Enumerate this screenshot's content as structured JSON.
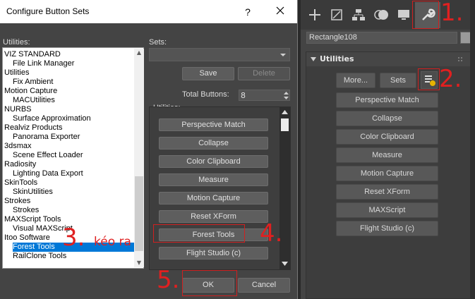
{
  "dialog": {
    "title": "Configure Button Sets",
    "help": "?",
    "utilities_label": "Utilities:",
    "sets_label": "Sets:",
    "save": "Save",
    "delete": "Delete",
    "total_buttons_label": "Total Buttons:",
    "total_buttons_value": "8",
    "utilities_label2": "Utilities:",
    "ok": "OK",
    "cancel": "Cancel",
    "list": [
      {
        "text": "VIZ STANDARD",
        "indent": false
      },
      {
        "text": "File Link Manager",
        "indent": true
      },
      {
        "text": "Utilities",
        "indent": false
      },
      {
        "text": "Fix Ambient",
        "indent": true
      },
      {
        "text": "Motion Capture",
        "indent": false
      },
      {
        "text": "MACUtilities",
        "indent": true
      },
      {
        "text": "NURBS",
        "indent": false
      },
      {
        "text": "Surface Approximation",
        "indent": true
      },
      {
        "text": "Realviz Products",
        "indent": false
      },
      {
        "text": "Panorama Exporter",
        "indent": true
      },
      {
        "text": "3dsmax",
        "indent": false
      },
      {
        "text": "Scene Effect Loader",
        "indent": true
      },
      {
        "text": "Radiosity",
        "indent": false
      },
      {
        "text": "Lighting Data Export",
        "indent": true
      },
      {
        "text": "SkinTools",
        "indent": false
      },
      {
        "text": "SkinUtilities",
        "indent": true
      },
      {
        "text": "Strokes",
        "indent": false
      },
      {
        "text": "Strokes",
        "indent": true
      },
      {
        "text": "MAXScript Tools",
        "indent": false
      },
      {
        "text": "Visual MAXScript",
        "indent": true
      },
      {
        "text": "Itoo Software",
        "indent": false
      },
      {
        "text": "Forest Tools",
        "indent": true,
        "selected": true
      },
      {
        "text": "RailClone Tools",
        "indent": true
      }
    ],
    "utility_buttons": [
      "Perspective Match",
      "Collapse",
      "Color Clipboard",
      "Measure",
      "Motion Capture",
      "Reset XForm",
      "Forest Tools",
      "Flight Studio (c)"
    ]
  },
  "panel": {
    "object_name": "Rectangle108",
    "rollout_title": "Utilities",
    "more": "More...",
    "sets": "Sets",
    "buttons": [
      "Perspective Match",
      "Collapse",
      "Color Clipboard",
      "Measure",
      "Motion Capture",
      "Reset XForm",
      "MAXScript",
      "Flight Studio (c)"
    ]
  },
  "annotations": {
    "a1": "1.",
    "a2": "2.",
    "a3": "3.",
    "a3_text": "kéo ra",
    "a4": "4.",
    "a5": "5."
  },
  "colors": {
    "annotation": "#e02020",
    "selection": "#0078d7"
  }
}
